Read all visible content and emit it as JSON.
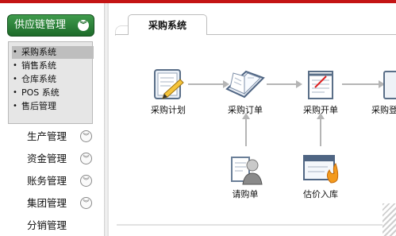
{
  "sidebar": {
    "main_menu": {
      "label": "供应链管理",
      "icon": "chevron-circle-down-icon"
    },
    "sub_items": [
      {
        "label": "采购系统",
        "active": true
      },
      {
        "label": "销售系统",
        "active": false
      },
      {
        "label": "仓库系统",
        "active": false
      },
      {
        "label": "POS 系统",
        "active": false
      },
      {
        "label": "售后管理",
        "active": false
      }
    ],
    "nav_items": [
      {
        "label": "生产管理",
        "icon": "chevron-circle-down-icon"
      },
      {
        "label": "资金管理",
        "icon": "chevron-circle-down-icon"
      },
      {
        "label": "账务管理",
        "icon": "chevron-circle-down-icon"
      },
      {
        "label": "集团管理",
        "icon": "chevron-circle-down-icon"
      },
      {
        "label": "分销管理"
      }
    ]
  },
  "content": {
    "tab_title": "采购系统",
    "flow_nodes": {
      "plan": "采购计划",
      "order": "采购订单",
      "invoice": "采购开单",
      "next": "采购登",
      "request": "请购单",
      "estimate": "估价入库"
    }
  },
  "colors": {
    "accent_red": "#c41414",
    "menu_green": "#2a7f36",
    "line_gray": "#b5b5b5"
  }
}
